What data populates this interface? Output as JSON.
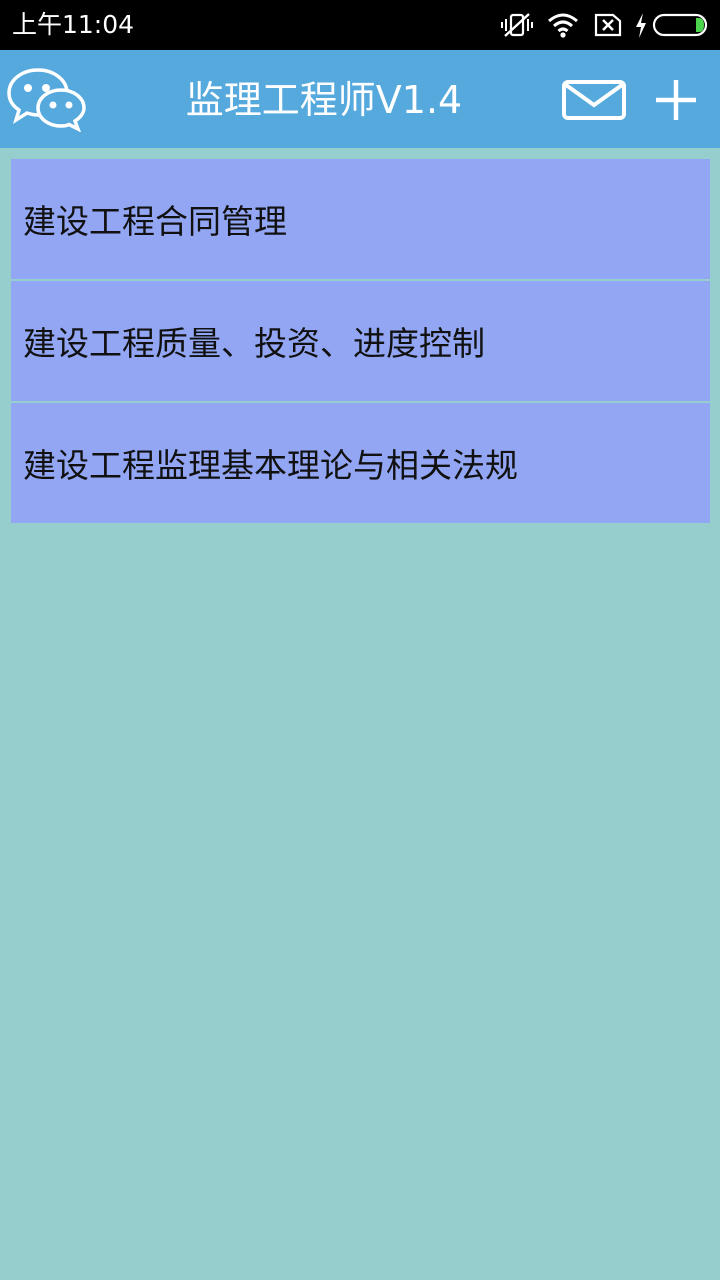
{
  "status_bar": {
    "time": "上午11:04",
    "icons": [
      "vibrate-icon",
      "wifi-icon",
      "no-sim-icon",
      "charging-icon",
      "battery-icon"
    ]
  },
  "app_bar": {
    "logo_icon": "wechat-icon",
    "title": "监理工程师V1.4",
    "actions": [
      "mail-icon",
      "plus-icon"
    ],
    "color": "#55a9dd"
  },
  "list": {
    "items": [
      {
        "label": "建设工程合同管理"
      },
      {
        "label": "建设工程质量、投资、进度控制"
      },
      {
        "label": "建设工程监理基本理论与相关法规"
      }
    ],
    "item_color": "#93a6f4"
  },
  "background_color": "#96cecd"
}
